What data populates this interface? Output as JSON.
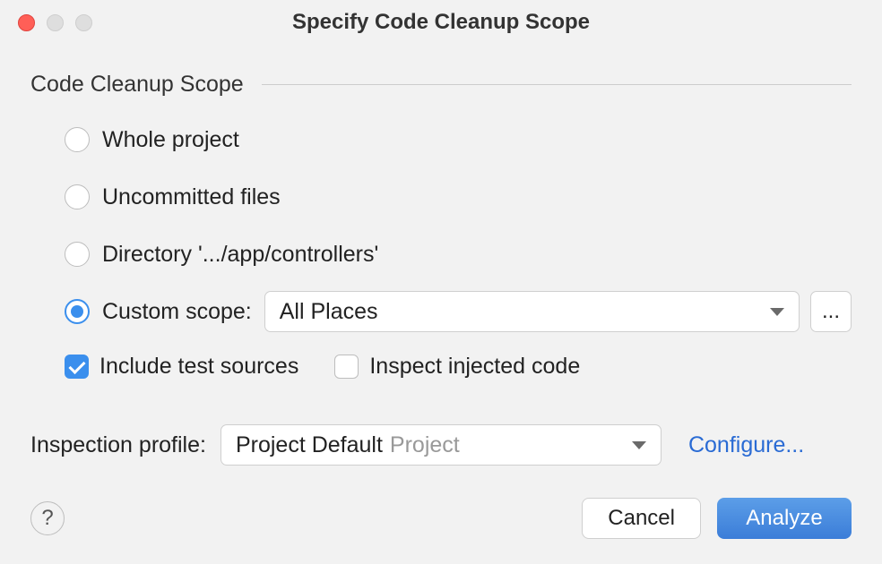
{
  "window": {
    "title": "Specify Code Cleanup Scope"
  },
  "group": {
    "title": "Code Cleanup Scope"
  },
  "radios": {
    "whole_project": "Whole project",
    "uncommitted": "Uncommitted files",
    "directory": "Directory '.../app/controllers'",
    "custom_scope": "Custom scope:"
  },
  "scope_select": {
    "value": "All Places"
  },
  "ellipsis": "...",
  "checkboxes": {
    "include_test": "Include test sources",
    "inspect_injected": "Inspect injected code"
  },
  "profile": {
    "label": "Inspection profile:",
    "value": "Project Default",
    "hint": "Project"
  },
  "configure": "Configure...",
  "help": "?",
  "buttons": {
    "cancel": "Cancel",
    "analyze": "Analyze"
  }
}
